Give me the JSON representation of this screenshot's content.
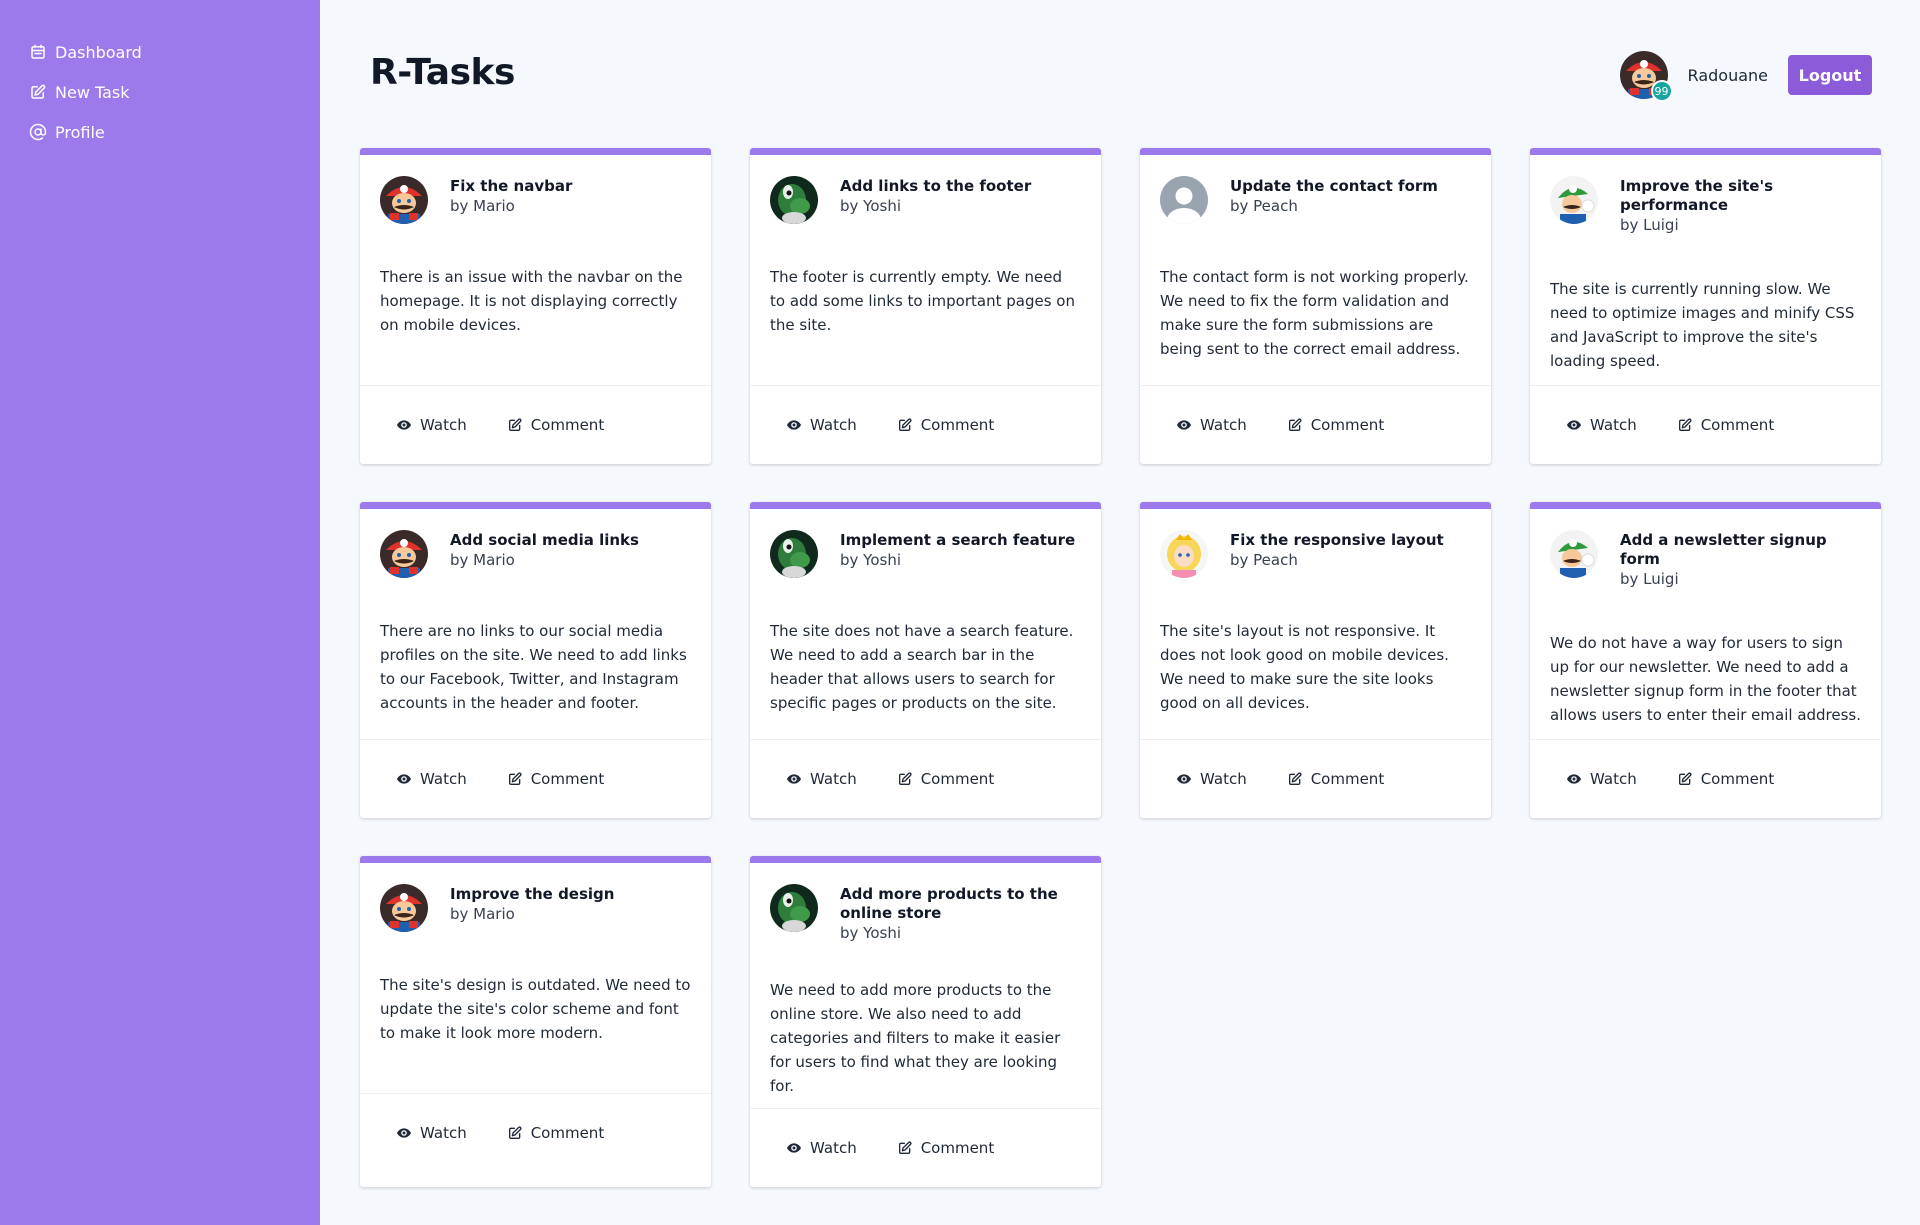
{
  "app": {
    "title": "R-Tasks"
  },
  "sidebar": {
    "items": [
      {
        "label": "Dashboard",
        "icon": "calendar-icon"
      },
      {
        "label": "New Task",
        "icon": "edit-icon"
      },
      {
        "label": "Profile",
        "icon": "at-icon"
      }
    ]
  },
  "header": {
    "username": "Radouane",
    "badge": "99",
    "logout_label": "Logout"
  },
  "actions": {
    "watch": "Watch",
    "comment": "Comment"
  },
  "colors": {
    "sidebar": "#9d7aec",
    "accent": "#8c5bd9",
    "badge": "#16a5a1",
    "background": "#f5f8fc"
  },
  "tasks": [
    {
      "title": "Fix the navbar",
      "author": "by Mario",
      "avatar": "mario",
      "description": "There is an issue with the navbar on the homepage. It is not displaying correctly on mobile devices."
    },
    {
      "title": "Add links to the footer",
      "author": "by Yoshi",
      "avatar": "yoshi",
      "description": "The footer is currently empty. We need to add some links to important pages on the site."
    },
    {
      "title": "Update the contact form",
      "author": "by Peach",
      "avatar": "default",
      "description": "The contact form is not working properly. We need to fix the form validation and make sure the form submissions are being sent to the correct email address."
    },
    {
      "title": "Improve the site's performance",
      "author": "by Luigi",
      "avatar": "luigi",
      "description": "The site is currently running slow. We need to optimize images and minify CSS and JavaScript to improve the site's loading speed."
    },
    {
      "title": "Add social media links",
      "author": "by Mario",
      "avatar": "mario",
      "description": "There are no links to our social media profiles on the site. We need to add links to our Facebook, Twitter, and Instagram accounts in the header and footer."
    },
    {
      "title": "Implement a search feature",
      "author": "by Yoshi",
      "avatar": "yoshi",
      "description": "The site does not have a search feature. We need to add a search bar in the header that allows users to search for specific pages or products on the site."
    },
    {
      "title": "Fix the responsive layout",
      "author": "by Peach",
      "avatar": "peach",
      "description": "The site's layout is not responsive. It does not look good on mobile devices. We need to make sure the site looks good on all devices."
    },
    {
      "title": "Add a newsletter signup form",
      "author": "by Luigi",
      "avatar": "luigi",
      "description": "We do not have a way for users to sign up for our newsletter. We need to add a newsletter signup form in the footer that allows users to enter their email address."
    },
    {
      "title": "Improve the design",
      "author": "by Mario",
      "avatar": "mario",
      "description": "The site's design is outdated. We need to update the site's color scheme and font to make it look more modern."
    },
    {
      "title": "Add more products to the online store",
      "author": "by Yoshi",
      "avatar": "yoshi",
      "description": "We need to add more products to the online store. We also need to add categories and filters to make it easier for users to find what they are looking for."
    }
  ]
}
